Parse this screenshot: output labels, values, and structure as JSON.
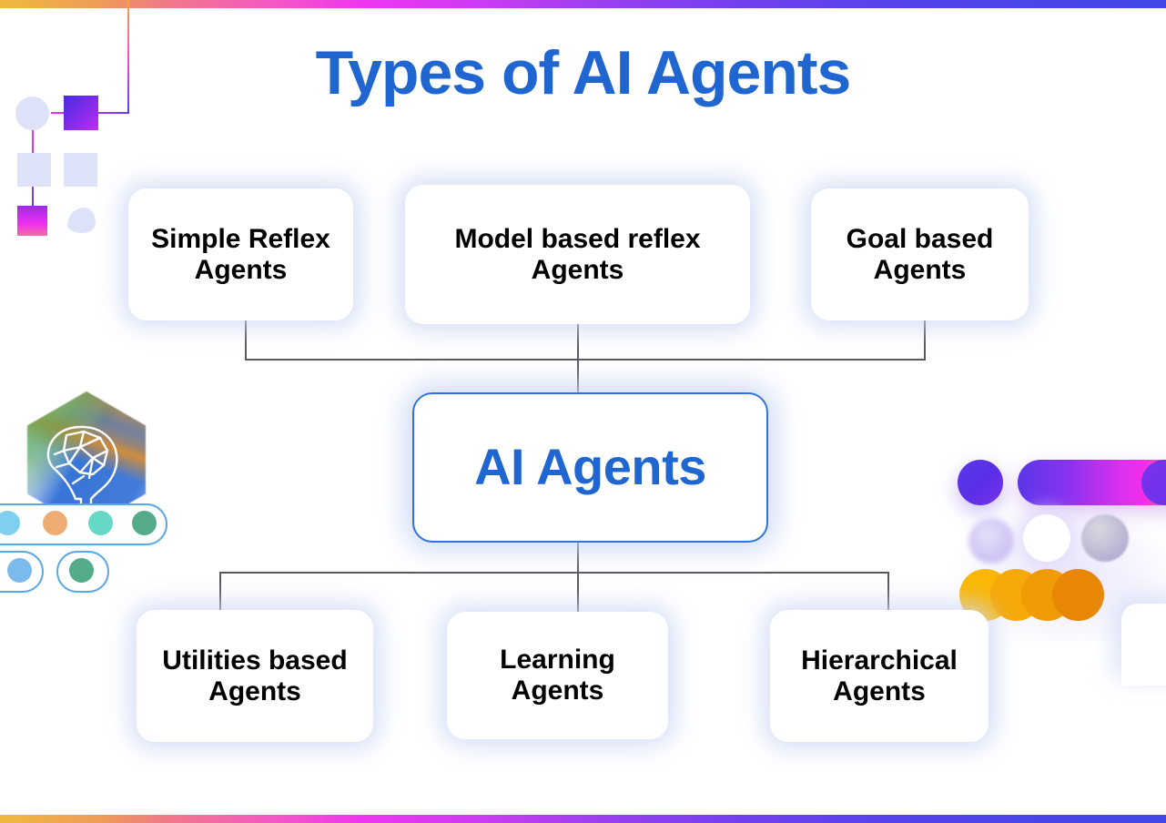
{
  "page": {
    "title": "Types of AI Agents",
    "title_color": "#1f66d0",
    "background": "#ffffff"
  },
  "diagram": {
    "type": "hierarchy",
    "center_node": {
      "label": "AI Agents",
      "text_color": "#1f66d0",
      "border_color": "#2e74da"
    },
    "top_nodes": [
      {
        "label": "Simple Reflex Agents"
      },
      {
        "label": "Model based reflex Agents"
      },
      {
        "label": "Goal based Agents"
      }
    ],
    "bottom_nodes": [
      {
        "label": "Utilities based Agents"
      },
      {
        "label": "Learning Agents"
      },
      {
        "label": "Hierarchical Agents"
      }
    ],
    "connector_color": "#58585e"
  },
  "decorations": {
    "top_bar": "gradient-bar-orange-magenta-blue",
    "bottom_bar": "gradient-bar-orange-magenta-blue",
    "left_widget": "squares-and-circles-node-graphic",
    "left_illustration": "brain-hexagon-icon",
    "right_cluster": "circles-and-gradient-pill-graphic",
    "accent_colors": [
      "#f0b93f",
      "#ef36ef",
      "#7140ef",
      "#4346e6",
      "#fab706",
      "#54ab8a"
    ]
  }
}
